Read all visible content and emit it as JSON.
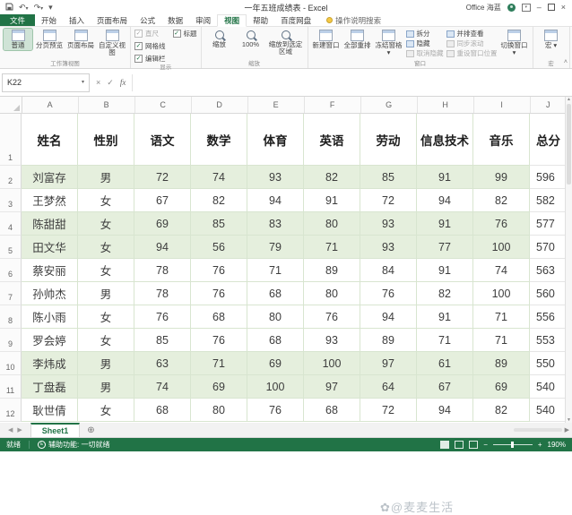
{
  "title_bar": {
    "title": "一年五班成绩表 - Excel",
    "account": "Office 海蓝",
    "minimize": "–",
    "close": "×"
  },
  "ribbon": {
    "file_tab": "文件",
    "tabs": [
      "文件",
      "开始",
      "插入",
      "页面布局",
      "公式",
      "数据",
      "审阅",
      "视图",
      "帮助",
      "百度网盘"
    ],
    "active_tab": "视图",
    "search_label": "操作说明搜索",
    "collapse_glyph": "˄",
    "groups": {
      "views": {
        "label": "工作簿视图",
        "buttons": [
          {
            "label": "普通",
            "selected": true
          },
          {
            "label": "分页预览"
          },
          {
            "label": "页面布局"
          },
          {
            "label": "自定义视图"
          }
        ]
      },
      "show": {
        "label": "显示",
        "checks": [
          {
            "label": "直尺",
            "checked": true,
            "disabled": true
          },
          {
            "label": "网格线",
            "checked": true
          },
          {
            "label": "编辑栏",
            "checked": true
          },
          {
            "label": "标题",
            "checked": true
          }
        ]
      },
      "zoom": {
        "label": "缩放",
        "buttons": [
          {
            "label": "缩放"
          },
          {
            "label": "100%"
          },
          {
            "label": "缩放到选定区域",
            "wide": true
          }
        ]
      },
      "window": {
        "label": "窗口",
        "big": [
          {
            "label": "新建窗口"
          },
          {
            "label": "全部重排"
          },
          {
            "label": "冻结窗格",
            "arrow": true
          }
        ],
        "small1": [
          {
            "label": "拆分"
          },
          {
            "label": "隐藏"
          },
          {
            "label": "取消隐藏",
            "disabled": true
          }
        ],
        "small2": [
          {
            "label": "并排查看"
          },
          {
            "label": "同步滚动",
            "disabled": true
          },
          {
            "label": "重设窗口位置",
            "disabled": true
          }
        ],
        "switch": {
          "label": "切换窗口",
          "arrow": true
        }
      },
      "macros": {
        "label": "宏",
        "button": "宏"
      }
    }
  },
  "formula_bar": {
    "name_box": "K22",
    "cancel": "×",
    "enter": "✓",
    "fx": "fx"
  },
  "sheet": {
    "col_letters": [
      "A",
      "B",
      "C",
      "D",
      "E",
      "F",
      "G",
      "H",
      "I",
      "J"
    ],
    "header_row": {
      "n": "1",
      "cells": [
        "姓名",
        "性别",
        "语文",
        "数学",
        "体育",
        "英语",
        "劳动",
        "信息技术",
        "音乐",
        "总分"
      ]
    },
    "rows": [
      {
        "n": "2",
        "band": true,
        "cells": [
          "刘富存",
          "男",
          "72",
          "74",
          "93",
          "82",
          "85",
          "91",
          "99",
          "596"
        ]
      },
      {
        "n": "3",
        "band": false,
        "cells": [
          "王梦然",
          "女",
          "67",
          "82",
          "94",
          "91",
          "72",
          "94",
          "82",
          "582"
        ]
      },
      {
        "n": "4",
        "band": true,
        "cells": [
          "陈甜甜",
          "女",
          "69",
          "85",
          "83",
          "80",
          "93",
          "91",
          "76",
          "577"
        ]
      },
      {
        "n": "5",
        "band": true,
        "cells": [
          "田文华",
          "女",
          "94",
          "56",
          "79",
          "71",
          "93",
          "77",
          "100",
          "570"
        ]
      },
      {
        "n": "6",
        "band": false,
        "cells": [
          "蔡安丽",
          "女",
          "78",
          "76",
          "71",
          "89",
          "84",
          "91",
          "74",
          "563"
        ]
      },
      {
        "n": "7",
        "band": false,
        "cells": [
          "孙帅杰",
          "男",
          "78",
          "76",
          "68",
          "80",
          "76",
          "82",
          "100",
          "560"
        ]
      },
      {
        "n": "8",
        "band": false,
        "cells": [
          "陈小雨",
          "女",
          "76",
          "68",
          "80",
          "76",
          "94",
          "91",
          "71",
          "556"
        ]
      },
      {
        "n": "9",
        "band": false,
        "cells": [
          "罗会婷",
          "女",
          "85",
          "76",
          "68",
          "93",
          "89",
          "71",
          "71",
          "553"
        ]
      },
      {
        "n": "10",
        "band": true,
        "cells": [
          "李炜成",
          "男",
          "63",
          "71",
          "69",
          "100",
          "97",
          "61",
          "89",
          "550"
        ]
      },
      {
        "n": "11",
        "band": true,
        "cells": [
          "丁盘磊",
          "男",
          "74",
          "69",
          "100",
          "97",
          "64",
          "67",
          "69",
          "540"
        ]
      },
      {
        "n": "12",
        "band": false,
        "cells": [
          "耿世倩",
          "女",
          "68",
          "80",
          "76",
          "68",
          "72",
          "94",
          "82",
          "540"
        ]
      }
    ]
  },
  "sheet_bar": {
    "tab": "Sheet1"
  },
  "status_bar": {
    "ready": "就绪",
    "accessibility": "辅助功能: 一切就绪",
    "zoom_level": "190%"
  },
  "watermark": "✿@麦麦生活",
  "colors": {
    "accent": "#217346",
    "band": "#e5efdd"
  }
}
